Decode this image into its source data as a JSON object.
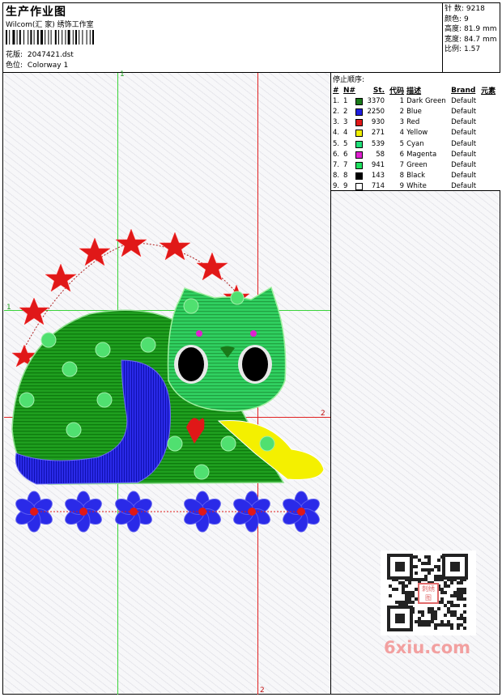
{
  "header": {
    "title": "生产作业图",
    "company": "Wilcom(汇 家) 绣饰工作室",
    "design_label": "花版:",
    "design_file": "2047421.dst",
    "colorway_label": "色位:",
    "colorway": "Colorway 1"
  },
  "stats": [
    {
      "label": "针 数:",
      "value": "9218"
    },
    {
      "label": "颜色:",
      "value": "9"
    },
    {
      "label": "高度:",
      "value": "81.9 mm"
    },
    {
      "label": "宽度:",
      "value": "84.7 mm"
    },
    {
      "label": "比例:",
      "value": "1.57"
    }
  ],
  "stop_sequence": {
    "title": "停止顺序:",
    "headers": {
      "num": "#",
      "n": "N#",
      "st": "St.",
      "code": "代码",
      "desc": "描述",
      "brand": "Brand",
      "element": "元素"
    },
    "rows": [
      {
        "num": "1.",
        "n": "1",
        "color": "#1a7a1a",
        "st": "3370",
        "code": "1",
        "desc": "Dark Green",
        "brand": "Default"
      },
      {
        "num": "2.",
        "n": "2",
        "color": "#1f1fe0",
        "st": "2250",
        "code": "2",
        "desc": "Blue",
        "brand": "Default"
      },
      {
        "num": "3.",
        "n": "3",
        "color": "#e01818",
        "st": "930",
        "code": "3",
        "desc": "Red",
        "brand": "Default"
      },
      {
        "num": "4.",
        "n": "4",
        "color": "#f0f000",
        "st": "271",
        "code": "4",
        "desc": "Yellow",
        "brand": "Default"
      },
      {
        "num": "5.",
        "n": "5",
        "color": "#22e07a",
        "st": "539",
        "code": "5",
        "desc": "Cyan",
        "brand": "Default"
      },
      {
        "num": "6.",
        "n": "6",
        "color": "#e020d0",
        "st": "58",
        "code": "6",
        "desc": "Magenta",
        "brand": "Default"
      },
      {
        "num": "7.",
        "n": "7",
        "color": "#20e060",
        "st": "941",
        "code": "7",
        "desc": "Green",
        "brand": "Default"
      },
      {
        "num": "8.",
        "n": "8",
        "color": "#000000",
        "st": "143",
        "code": "8",
        "desc": "Black",
        "brand": "Default"
      },
      {
        "num": "9.",
        "n": "9",
        "color": "#ffffff",
        "st": "714",
        "code": "9",
        "desc": "White",
        "brand": "Default"
      }
    ]
  },
  "guides": {
    "top_v1": "1",
    "left_h1": "1",
    "right_h2": "2",
    "bottom_v2": "2"
  },
  "watermark": {
    "qr_center": "刺绣图",
    "site": "6xiu.com"
  },
  "icons": {
    "barcode": "barcode-icon",
    "qr": "qr-code-icon"
  }
}
